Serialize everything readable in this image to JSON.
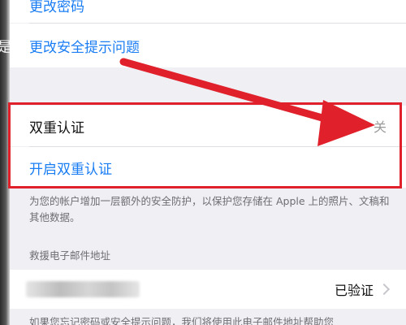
{
  "settings": {
    "change_password": "更改密码",
    "change_security_questions": "更改安全提示问题",
    "two_factor": {
      "label": "双重认证",
      "value": "关"
    },
    "enable_two_factor": "开启双重认证",
    "footnote": "为您的帐户增加一层额外的安全防护，以保护您存储在 Apple 上的照片、文稿和其他数据。",
    "rescue_email": {
      "header": "救援电子邮件地址",
      "status": "已验证"
    },
    "bottom_text": "如果您忘记密码或安全提示问题，我们将使用此电子邮件地址帮助您"
  },
  "left_edge_glyph": "是",
  "colors": {
    "link": "#1a7df3",
    "annotation": "#e0202a"
  },
  "icons": [
    "chevron-right-icon",
    "annotation-arrow"
  ]
}
